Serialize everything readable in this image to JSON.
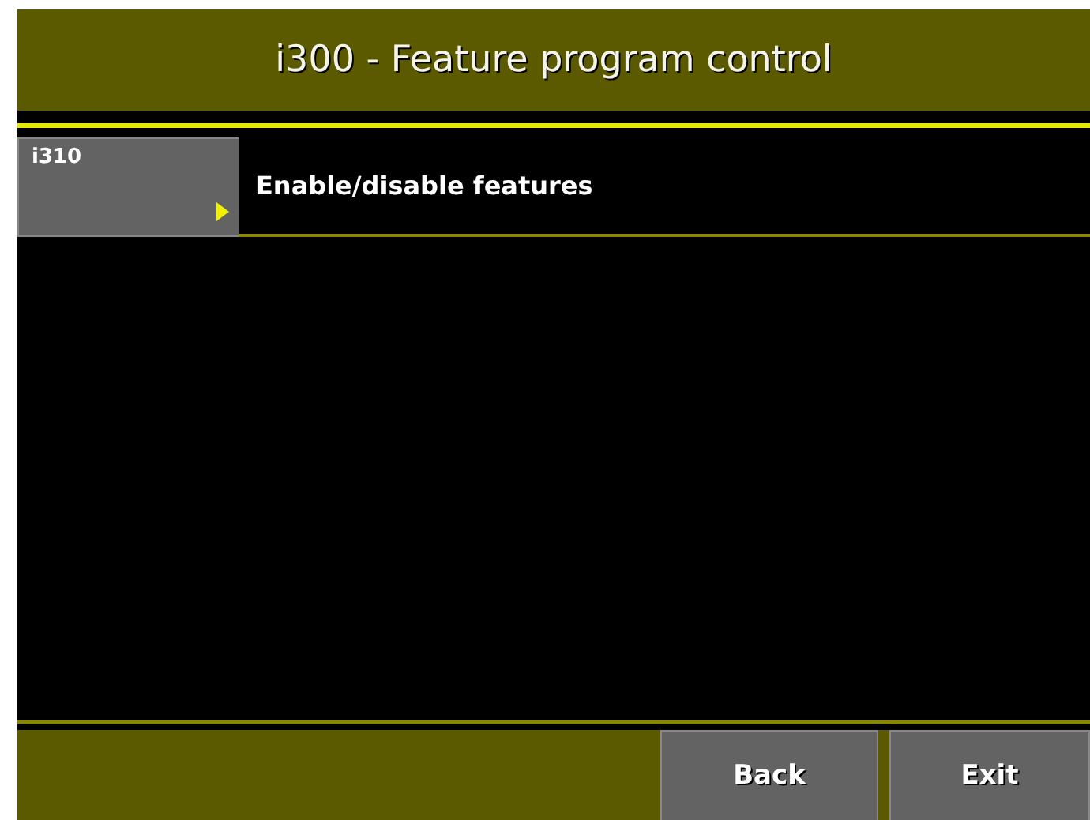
{
  "header": {
    "title": "i300 - Feature program control"
  },
  "menu_items": [
    {
      "code": "i310",
      "label": "Enable/disable features"
    }
  ],
  "buttons": [
    {
      "label": "Back"
    },
    {
      "label": "Exit"
    }
  ]
}
